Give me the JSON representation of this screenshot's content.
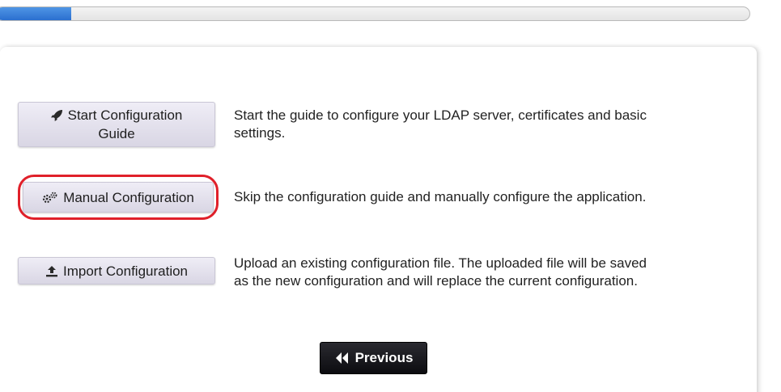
{
  "progress": {
    "percent": 10
  },
  "options": [
    {
      "icon": "rocket-icon",
      "button_label_line1": "Start Configuration",
      "button_label_line2": "Guide",
      "description_line1": "Start the guide to configure your LDAP server, certificates and basic",
      "description_line2": "settings."
    },
    {
      "icon": "gears-icon",
      "button_label": "Manual Configuration",
      "highlighted": true,
      "description": "Skip the configuration guide and manually configure the application."
    },
    {
      "icon": "upload-icon",
      "button_label": "Import Configuration",
      "description_line1": "Upload an existing configuration file. The uploaded file will be saved",
      "description_line2": "as the new configuration and will replace the current configuration."
    }
  ],
  "nav": {
    "previous_icon": "double-chevron-left-icon",
    "previous_label": "Previous"
  },
  "colors": {
    "progress_fill": "#2b6fcf",
    "highlight_ring": "#e0202a",
    "button_bg": "#d9d6e4",
    "previous_bg": "#0c0c10"
  }
}
